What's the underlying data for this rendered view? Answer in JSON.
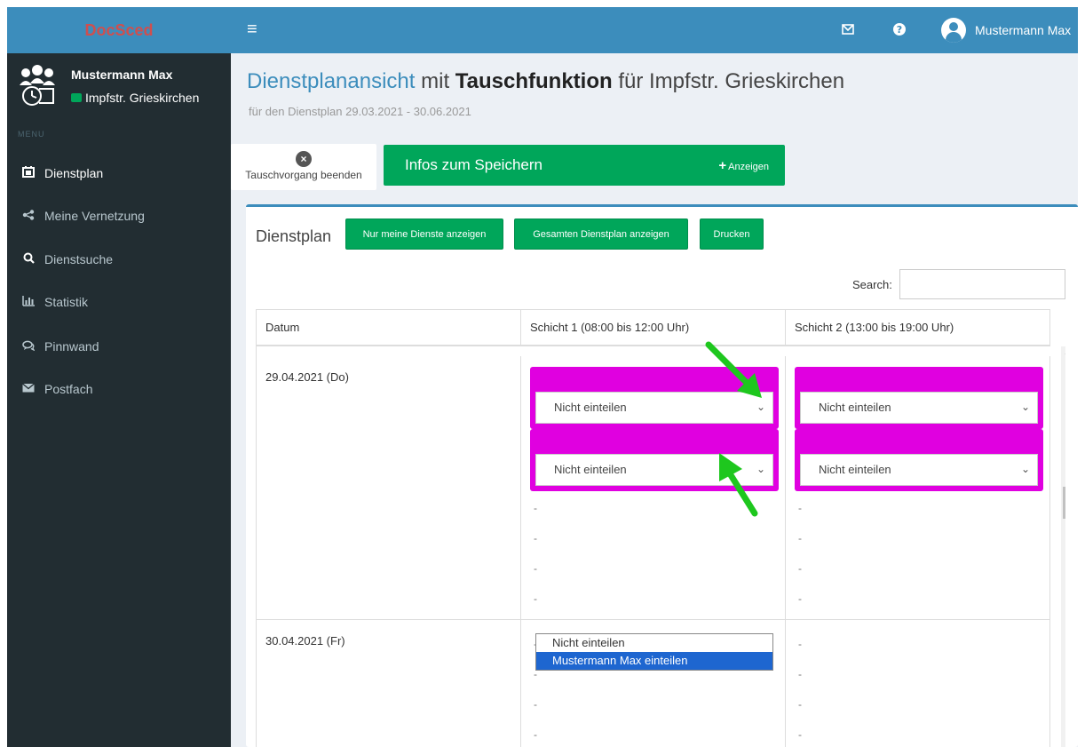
{
  "app": {
    "brand": "DocSced"
  },
  "topbar": {
    "mail_icon": "envelope-icon",
    "help_icon": "question-icon",
    "user_name": "Mustermann Max"
  },
  "sidebar": {
    "user_name": "Mustermann Max",
    "location": "Impfstr. Grieskirchen",
    "menu_header": "MENU",
    "items": [
      {
        "label": "Dienstplan",
        "icon": "calendar-icon",
        "active": true
      },
      {
        "label": "Meine Vernetzung",
        "icon": "share-icon",
        "active": false
      },
      {
        "label": "Dienstsuche",
        "icon": "search-icon",
        "active": false
      },
      {
        "label": "Statistik",
        "icon": "bar-chart-icon",
        "active": false
      },
      {
        "label": "Pinnwand",
        "icon": "comments-icon",
        "active": false
      },
      {
        "label": "Postfach",
        "icon": "envelope-icon",
        "active": false
      }
    ]
  },
  "header": {
    "title_part1": "Dienstplanansicht",
    "title_part2": " mit ",
    "title_bold": "Tauschfunktion",
    "title_part3": " für Impfstr. Grieskirchen",
    "subtitle": "für den Dienstplan 29.03.2021 - 30.06.2021"
  },
  "actions": {
    "end_swap_label": "Tauschvorgang beenden",
    "info_title": "Infos zum Speichern",
    "info_button": "Anzeigen"
  },
  "box": {
    "title": "Dienstplan",
    "btn_mine": "Nur meine Dienste anzeigen",
    "btn_all": "Gesamten Dienstplan anzeigen",
    "btn_print": "Drucken",
    "search_label": "Search:"
  },
  "table": {
    "headers": [
      "Datum",
      "Schicht 1 (08:00 bis 12:00 Uhr)",
      "Schicht 2 (13:00 bis 19:00 Uhr)"
    ],
    "rows": [
      {
        "date": "29.04.2021 (Do)"
      },
      {
        "date": "30.04.2021 (Fr)"
      }
    ],
    "select_value": "Nicht einteilen",
    "dash": "-"
  },
  "dropdown": {
    "options": [
      "Nicht einteilen",
      "Mustermann Max einteilen"
    ],
    "highlighted_index": 1
  },
  "colors": {
    "primary": "#3c8dbc",
    "success": "#00a65a",
    "sidebar": "#222d32",
    "slot": "#e000e0",
    "arrow": "#1ec71e"
  }
}
